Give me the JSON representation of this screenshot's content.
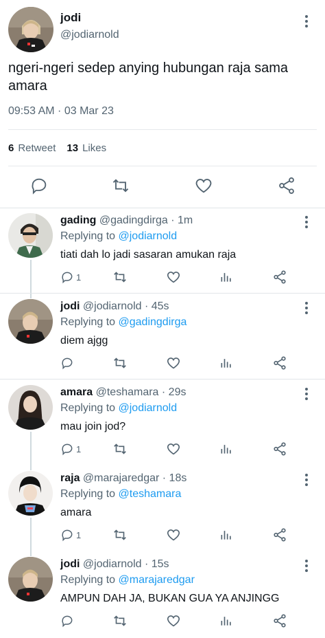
{
  "main_tweet": {
    "name": "jodi",
    "handle": "@jodiarnold",
    "text": "ngeri-ngeri sedep anying hubungan raja sama amara",
    "timestamp": "09:53 AM · 03 Mar 23",
    "retweets": {
      "count": "6",
      "label": "Retweet"
    },
    "likes": {
      "count": "13",
      "label": "Likes"
    },
    "actions": [
      "reply-icon",
      "retweet-icon",
      "like-icon",
      "share-icon"
    ]
  },
  "replies": [
    {
      "name": "gading",
      "meta": "@gadingdirga · 1m",
      "replying_prefix": "Replying to",
      "replying_to": "@jodiarnold",
      "text": "tiati dah lo jadi sasaran amukan raja",
      "reply_count": "1"
    },
    {
      "name": "jodi",
      "meta": "@jodiarnold · 45s",
      "replying_prefix": "Replying to",
      "replying_to": "@gadingdirga",
      "text": "diem ajgg",
      "reply_count": ""
    },
    {
      "name": "amara",
      "meta": "@teshamara · 29s",
      "replying_prefix": "Replying to",
      "replying_to": "@jodiarnold",
      "text": "mau join jod?",
      "reply_count": "1"
    },
    {
      "name": "raja",
      "meta": "@marajaredgar · 18s",
      "replying_prefix": "Replying to",
      "replying_to": "@teshamara",
      "text": "amara",
      "reply_count": "1"
    },
    {
      "name": "jodi",
      "meta": "@jodiarnold · 15s",
      "replying_prefix": "Replying to",
      "replying_to": "@marajaredgar",
      "text": "AMPUN DAH JA, BUKAN GUA YA ANJINGG",
      "reply_count": ""
    }
  ],
  "colors": {
    "accent": "#1d9bf0",
    "muted": "#536471",
    "text": "#0f1419",
    "border": "#e1e5e8"
  }
}
